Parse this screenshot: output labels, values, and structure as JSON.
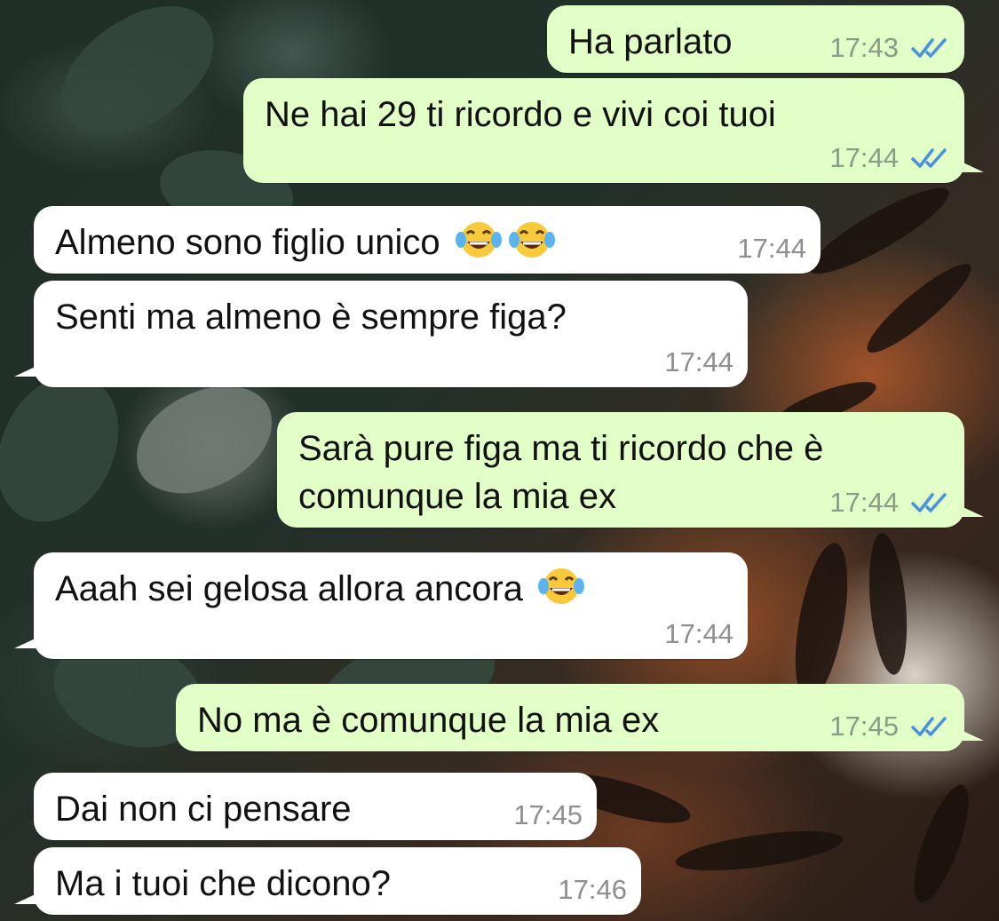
{
  "chat": {
    "messages": [
      {
        "id": "m1",
        "direction": "out",
        "text": "Ha parlato",
        "time": "17:43",
        "status": "read"
      },
      {
        "id": "m2",
        "direction": "out",
        "text": "Ne hai 29 ti ricordo e vivi coi tuoi",
        "time": "17:44",
        "status": "read"
      },
      {
        "id": "m3",
        "direction": "in",
        "text": "Almeno sono figlio unico",
        "emoji": [
          "face-with-tears-of-joy",
          "face-with-tears-of-joy"
        ],
        "time": "17:44"
      },
      {
        "id": "m4",
        "direction": "in",
        "text": "Senti ma almeno è sempre figa?",
        "time": "17:44"
      },
      {
        "id": "m5",
        "direction": "out",
        "text": "Sarà pure figa ma ti ricordo che è\ncomunque la mia ex",
        "time": "17:44",
        "status": "read"
      },
      {
        "id": "m6",
        "direction": "in",
        "text": "Aaah sei gelosa allora ancora",
        "emoji": [
          "face-with-tears-of-joy"
        ],
        "time": "17:44"
      },
      {
        "id": "m7",
        "direction": "out",
        "text": "No ma è comunque la mia ex",
        "time": "17:45",
        "status": "read"
      },
      {
        "id": "m8",
        "direction": "in",
        "text": "Dai non ci pensare",
        "time": "17:45"
      },
      {
        "id": "m9",
        "direction": "in",
        "text": "Ma i tuoi che dicono?",
        "time": "17:46"
      }
    ]
  },
  "colors": {
    "outgoing_bubble": "#e1ffc7",
    "incoming_bubble": "#ffffff",
    "read_ticks": "#4a90e2",
    "timestamp": "#8e8e93"
  },
  "icons": {
    "read_receipt": "double-check-icon",
    "emoji": "face-with-tears-of-joy-icon"
  }
}
